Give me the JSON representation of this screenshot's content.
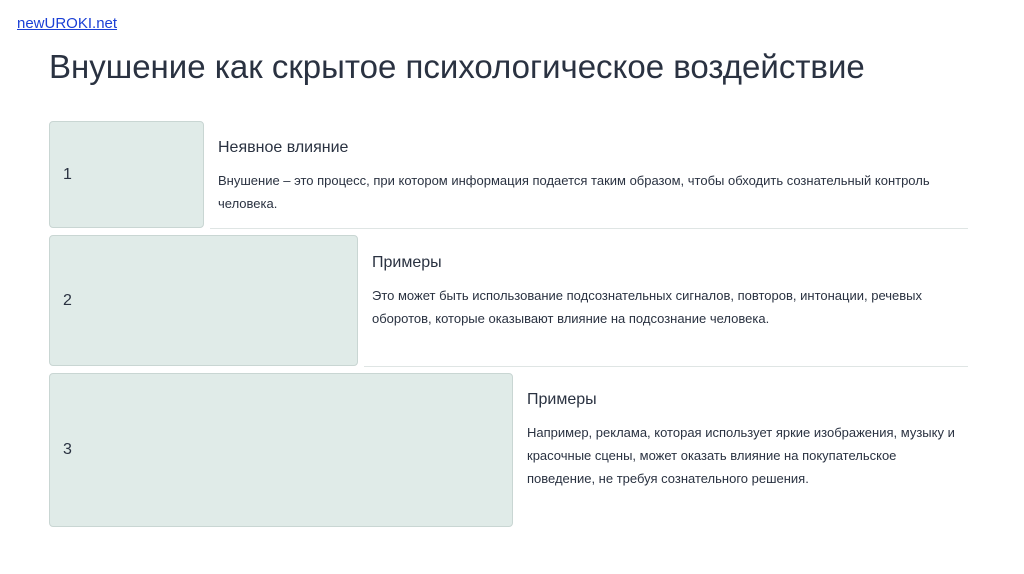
{
  "header": {
    "brand": "newUROKI.net",
    "title": "Внушение как скрытое психологическое воздействие"
  },
  "items": [
    {
      "number": "1",
      "title": "Неявное влияние",
      "description": "Внушение – это процесс, при котором информация подается таким образом, чтобы обходить сознательный контроль человека."
    },
    {
      "number": "2",
      "title": "Примеры",
      "description": "Это может быть использование подсознательных сигналов, повторов, интонации, речевых оборотов, которые оказывают влияние на подсознание человека."
    },
    {
      "number": "3",
      "title": "Примеры",
      "description": "Например, реклама, которая использует яркие изображения, музыку и красочные сцены, может оказать влияние на покупательское поведение, не требуя сознательного решения."
    }
  ],
  "colors": {
    "box_fill": "#e0ebe8",
    "link": "#1a3fd6",
    "text": "#2a3241"
  }
}
